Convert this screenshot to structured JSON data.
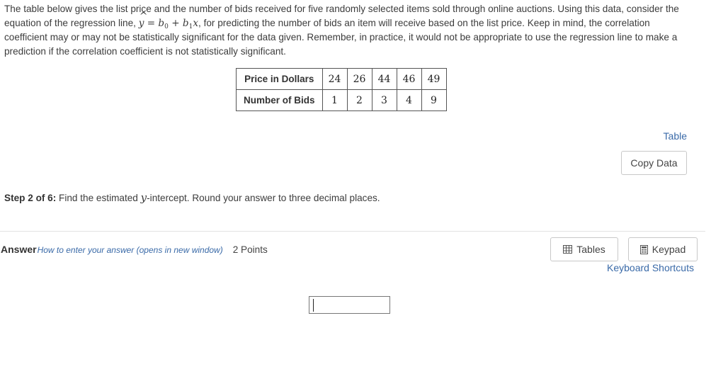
{
  "problem": {
    "part1": "The table below gives the list price and the number of bids received for five randomly selected items sold through online auctions. Using this data, consider the equation of the regression line,",
    "part2": ", for predicting the number of bids an item will receive based on the list price. Keep in mind, the correlation coefficient may or may not be statistically significant for the data given. Remember, in practice, it would not be appropriate to use the regression line to make a prediction if the correlation coefficient is not statistically significant.",
    "equation": {
      "yhat": "y",
      "eq": "=",
      "b0": "b",
      "b0_sub": "0",
      "plus": "+",
      "b1": "b",
      "b1_sub": "1",
      "x": "x"
    }
  },
  "table": {
    "row1_label": "Price in Dollars",
    "row1_values": [
      "24",
      "26",
      "44",
      "46",
      "49"
    ],
    "row2_label": "Number of Bids",
    "row2_values": [
      "1",
      "2",
      "3",
      "4",
      "9"
    ]
  },
  "links": {
    "table": "Table",
    "keyboard_shortcuts": "Keyboard Shortcuts",
    "how_to": "How to enter your answer (opens in new window)"
  },
  "buttons": {
    "copy_data": "Copy Data",
    "tables": "Tables",
    "keypad": "Keypad"
  },
  "step": {
    "label": "Step 2 of 6:",
    "text_before": " Find the estimated ",
    "var": "y",
    "text_after": "-intercept. Round your answer to three decimal places."
  },
  "answer": {
    "label": "Answer",
    "points": "2 Points",
    "value": ""
  },
  "icons": {
    "tables": "table-grid-icon",
    "keypad": "calculator-icon"
  }
}
